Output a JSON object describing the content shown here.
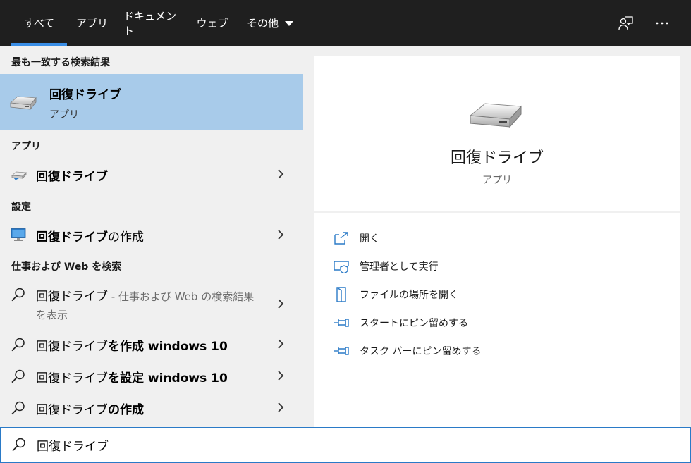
{
  "tabs": [
    {
      "label": "すべて",
      "active": true
    },
    {
      "label": "アプリ"
    },
    {
      "label": "ドキュメント"
    },
    {
      "label": "ウェブ"
    },
    {
      "label": "その他"
    }
  ],
  "topbar_icons": [
    "feedback-icon",
    "more-options-icon"
  ],
  "left": {
    "best_match_header": "最も一致する検索結果",
    "best_match": {
      "title": "回復ドライブ",
      "subtitle": "アプリ",
      "icon": "drive-icon"
    },
    "apps_header": "アプリ",
    "apps": [
      {
        "label": "回復ドライブ",
        "icon": "drive-small-icon"
      }
    ],
    "settings_header": "設定",
    "settings": [
      {
        "bold": "回復ドライブ",
        "rest": "の作成",
        "icon": "monitor-icon"
      }
    ],
    "web_header": "仕事および Web を検索",
    "web": [
      {
        "prefix": "回復ドライブ",
        "muted": " - 仕事および Web の検索結果",
        "line2": "を表示"
      },
      {
        "prefix": "回復ドライブ",
        "bold": "を作成 windows 10"
      },
      {
        "prefix": "回復ドライブ",
        "bold": "を設定 windows 10"
      },
      {
        "prefix": "回復ドライブ",
        "bold": "の作成"
      }
    ]
  },
  "right": {
    "title": "回復ドライブ",
    "subtitle": "アプリ",
    "actions": [
      {
        "label": "開く",
        "icon": "open-icon"
      },
      {
        "label": "管理者として実行",
        "icon": "shield-icon"
      },
      {
        "label": "ファイルの場所を開く",
        "icon": "file-location-icon"
      },
      {
        "label": "スタートにピン留めする",
        "icon": "pin-icon"
      },
      {
        "label": "タスク バーにピン留めする",
        "icon": "pin-icon"
      }
    ]
  },
  "search": {
    "value": "回復ドライブ"
  },
  "colors": {
    "accent": "#2a7ac7",
    "selected": "#a8cbea",
    "topbar": "#1f1f1f"
  }
}
